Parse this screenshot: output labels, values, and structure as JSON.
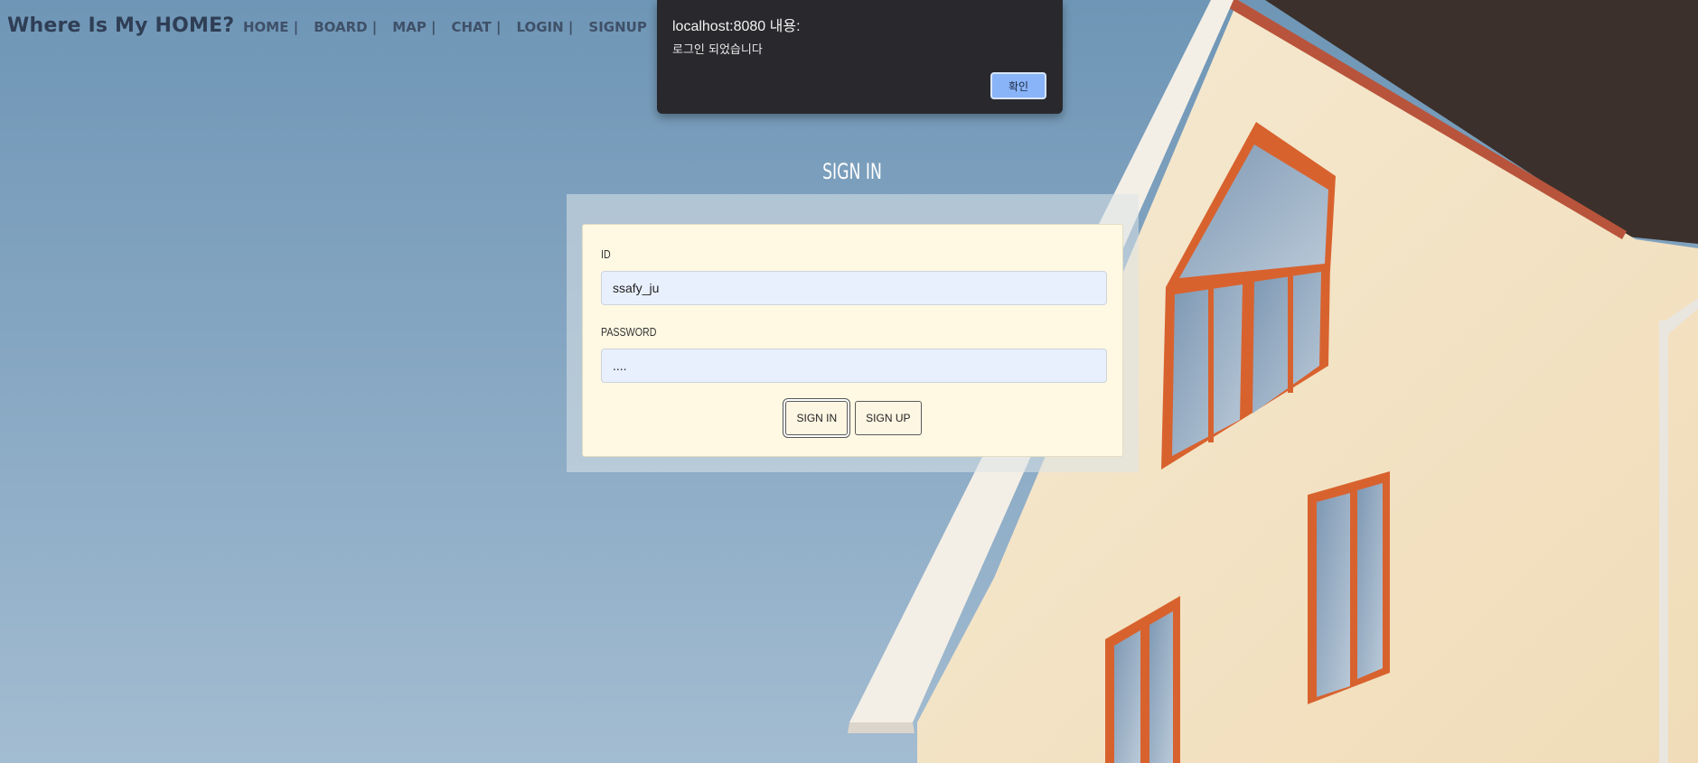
{
  "navbar": {
    "brand": "Where Is My HOME?",
    "links": [
      "HOME |",
      "BOARD |",
      "MAP |",
      "CHAT |",
      "LOGIN |",
      "SIGNUP"
    ]
  },
  "signin": {
    "title": "SIGN IN",
    "id_label": "ID",
    "id_value": "ssafy_ju",
    "password_label": "PASSWORD",
    "password_value": "....",
    "signin_button": "SIGN IN",
    "signup_button": "SIGN UP"
  },
  "alert": {
    "origin": "localhost:8080 내용:",
    "message": "로그인 되었습니다",
    "ok_button": "확인"
  },
  "colors": {
    "sky": "#7f9fbe",
    "wall": "#f3e3c4",
    "roof": "#3a302c",
    "window_frame": "#d8622e",
    "card_background": "#fff9e3",
    "input_background": "#e8f0fe",
    "alert_background": "#29292d",
    "alert_button": "#8ab4f8"
  }
}
